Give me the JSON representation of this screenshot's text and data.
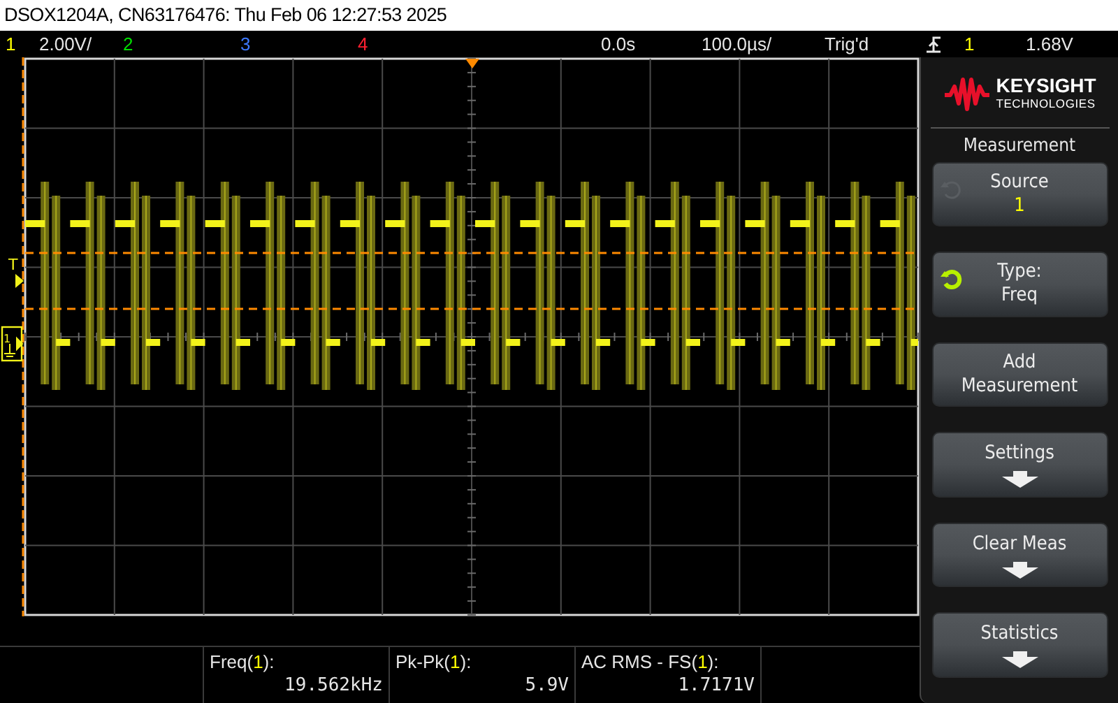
{
  "window": {
    "title": "DSOX1204A, CN63176476: Thu Feb 06 12:27:53 2025"
  },
  "status_bar": {
    "channels": [
      {
        "number": "1",
        "color": "#ffff00",
        "scale": "2.00V/"
      },
      {
        "number": "2",
        "color": "#00dd00"
      },
      {
        "number": "3",
        "color": "#3c78ff"
      },
      {
        "number": "4",
        "color": "#ff2030"
      }
    ],
    "time_offset": "0.0s",
    "timebase": "100.0µs/",
    "trigger_status": "Trig'd",
    "trigger_source": "1",
    "trigger_level": "1.68V"
  },
  "display": {
    "trigger_marker": "T",
    "ground_marker": "1"
  },
  "panel": {
    "logo_top": "KEYSIGHT",
    "logo_bottom": "TECHNOLOGIES",
    "heading": "Measurement",
    "softkeys": [
      {
        "kind": "knob",
        "active": false,
        "label": "Source",
        "value": "1"
      },
      {
        "kind": "knob",
        "active": true,
        "label": "Type:",
        "value": "Freq"
      },
      {
        "kind": "plain",
        "label": "Add\nMeasurement"
      },
      {
        "kind": "submenu",
        "label": "Settings"
      },
      {
        "kind": "submenu",
        "label": "Clear Meas"
      },
      {
        "kind": "submenu",
        "label": "Statistics"
      }
    ]
  },
  "measurements": [
    {
      "label_parts": [
        "Freq(",
        "1",
        "):"
      ],
      "value": "19.562kHz"
    },
    {
      "label_parts": [
        "Pk-Pk(",
        "1",
        "):"
      ],
      "value": "5.9V"
    },
    {
      "label_parts": [
        "AC RMS - FS(",
        "1",
        "):"
      ],
      "value": "1.7171V"
    }
  ]
}
